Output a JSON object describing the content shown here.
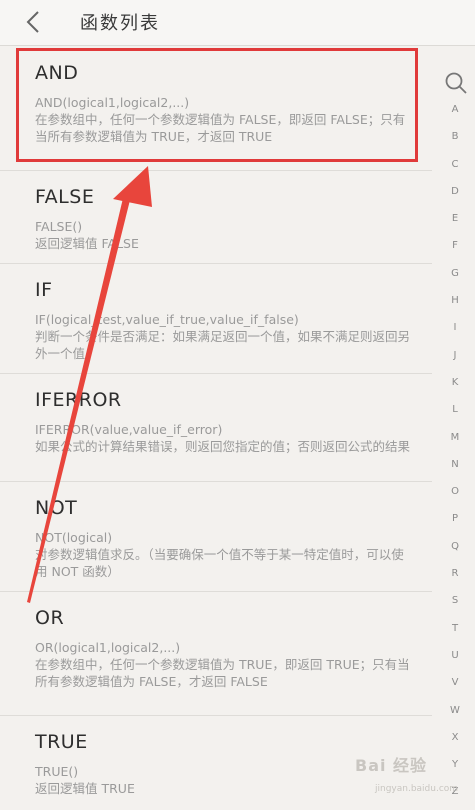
{
  "header": {
    "title": "函数列表",
    "back_icon": "chevron-left-icon"
  },
  "search": {
    "icon": "search-icon"
  },
  "functions": [
    {
      "name": "AND",
      "syntax": "AND(logical1,logical2,...)",
      "description": "在参数组中，任何一个参数逻辑值为 FALSE，即返回 FALSE；只有当所有参数逻辑值为 TRUE，才返回 TRUE"
    },
    {
      "name": "FALSE",
      "syntax": "FALSE()",
      "description": "返回逻辑值 FALSE"
    },
    {
      "name": "IF",
      "syntax": "IF(logical_test,value_if_true,value_if_false)",
      "description": "判断一个条件是否满足：如果满足返回一个值，如果不满足则返回另外一个值"
    },
    {
      "name": "IFERROR",
      "syntax": "IFERROR(value,value_if_error)",
      "description": "如果公式的计算结果错误，则返回您指定的值；否则返回公式的结果"
    },
    {
      "name": "NOT",
      "syntax": "NOT(logical)",
      "description": "对参数逻辑值求反。（当要确保一个值不等于某一特定值时，可以使用 NOT 函数）"
    },
    {
      "name": "OR",
      "syntax": "OR(logical1,logical2,...)",
      "description": "在参数组中，任何一个参数逻辑值为 TRUE，即返回 TRUE；只有当所有参数逻辑值为 FALSE，才返回 FALSE"
    },
    {
      "name": "TRUE",
      "syntax": "TRUE()",
      "description": "返回逻辑值 TRUE"
    }
  ],
  "index_letters": [
    "A",
    "B",
    "C",
    "D",
    "E",
    "F",
    "G",
    "H",
    "I",
    "J",
    "K",
    "L",
    "M",
    "N",
    "O",
    "P",
    "Q",
    "R",
    "S",
    "T",
    "U",
    "V",
    "W",
    "X",
    "Y",
    "Z"
  ],
  "watermark": {
    "text": "Bai 经验",
    "sub": "jingyan.baidu.com"
  },
  "colors": {
    "highlight": "#e03a3a",
    "arrow": "#e8453c",
    "background": "#f3f1ee"
  }
}
